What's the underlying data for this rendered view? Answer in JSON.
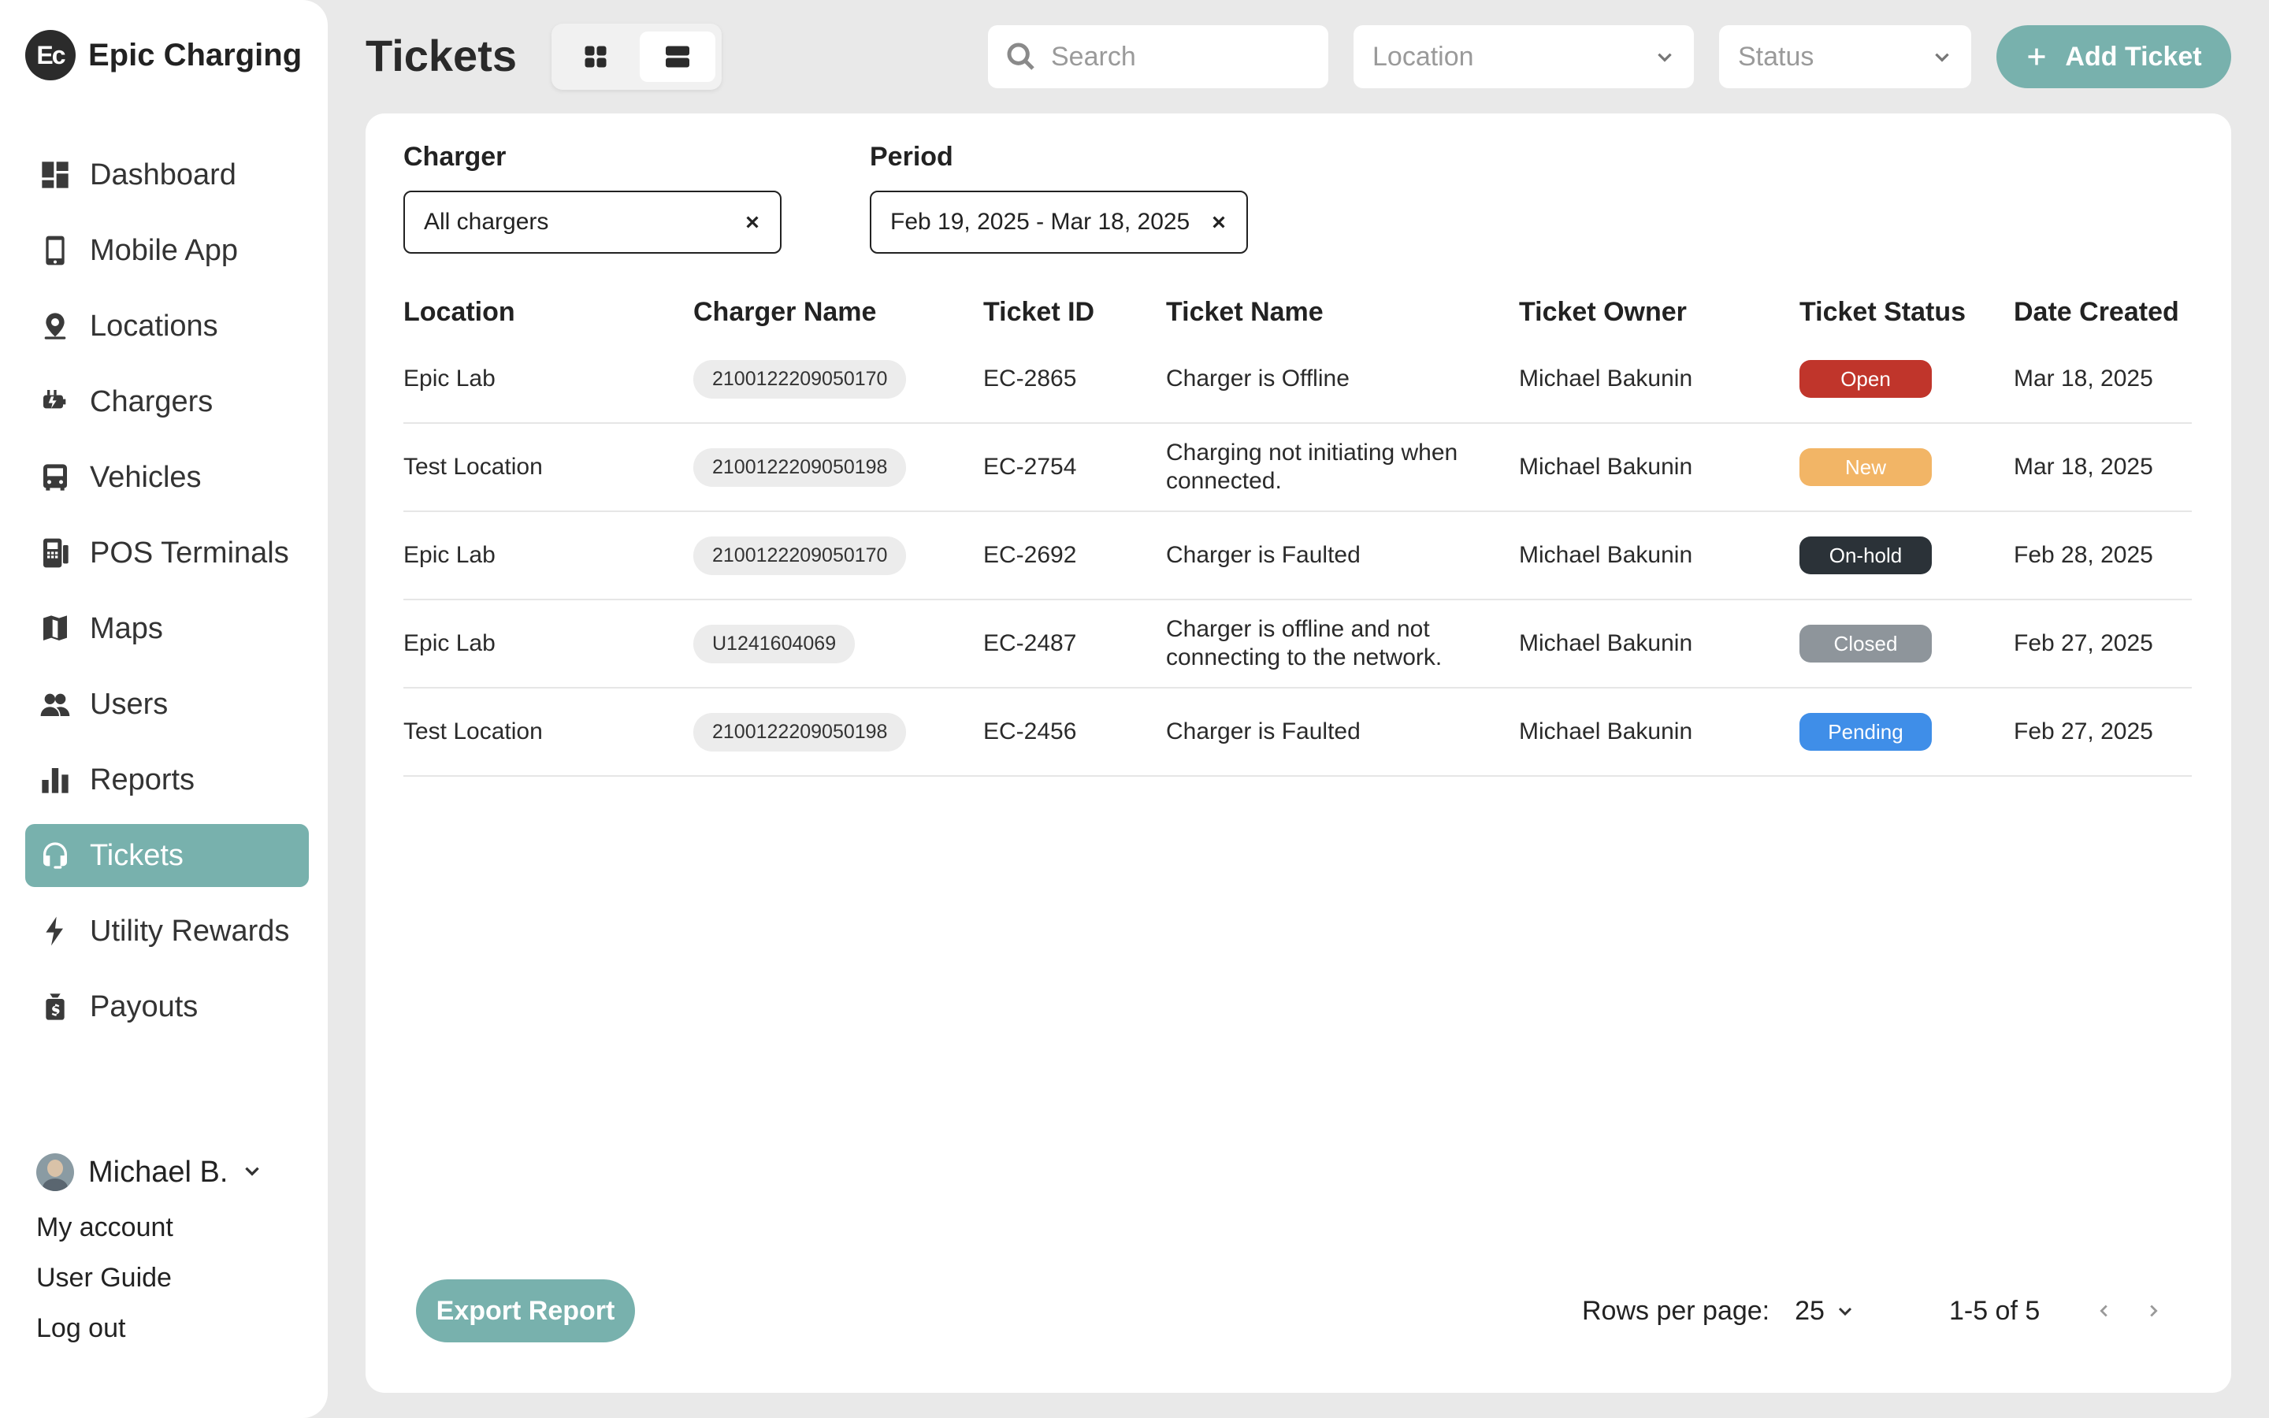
{
  "brand": {
    "logo_text": "Ec",
    "name": "Epic Charging"
  },
  "nav": [
    {
      "label": "Dashboard",
      "icon": "dashboard-icon"
    },
    {
      "label": "Mobile App",
      "icon": "mobile-phone-icon"
    },
    {
      "label": "Locations",
      "icon": "location-pin-icon"
    },
    {
      "label": "Chargers",
      "icon": "ev-charger-icon"
    },
    {
      "label": "Vehicles",
      "icon": "bus-icon"
    },
    {
      "label": "POS Terminals",
      "icon": "pos-terminal-icon"
    },
    {
      "label": "Maps",
      "icon": "map-icon"
    },
    {
      "label": "Users",
      "icon": "users-icon"
    },
    {
      "label": "Reports",
      "icon": "bar-chart-icon"
    },
    {
      "label": "Tickets",
      "icon": "headset-icon",
      "active": true
    },
    {
      "label": "Utility Rewards",
      "icon": "lightning-bolt-icon"
    },
    {
      "label": "Payouts",
      "icon": "money-bag-icon"
    }
  ],
  "user": {
    "name": "Michael B.",
    "links": [
      "My account",
      "User Guide",
      "Log out"
    ]
  },
  "header": {
    "title": "Tickets",
    "search_placeholder": "Search",
    "location_placeholder": "Location",
    "status_placeholder": "Status",
    "add_button": "Add Ticket"
  },
  "filters": {
    "charger": {
      "label": "Charger",
      "value": "All chargers"
    },
    "period": {
      "label": "Period",
      "value": "Feb 19, 2025 - Mar 18, 2025"
    }
  },
  "table": {
    "columns": [
      "Location",
      "Charger Name",
      "Ticket ID",
      "Ticket Name",
      "Ticket Owner",
      "Ticket Status",
      "Date Created"
    ],
    "rows": [
      {
        "location": "Epic Lab",
        "charger": "2100122209050170",
        "id": "EC-2865",
        "name": "Charger is Offline",
        "owner": "Michael Bakunin",
        "status": "Open",
        "date": "Mar 18, 2025"
      },
      {
        "location": "Test Location",
        "charger": "2100122209050198",
        "id": "EC-2754",
        "name": "Charging not initiating when connected.",
        "owner": "Michael Bakunin",
        "status": "New",
        "date": "Mar 18, 2025"
      },
      {
        "location": "Epic Lab",
        "charger": "2100122209050170",
        "id": "EC-2692",
        "name": "Charger is Faulted",
        "owner": "Michael Bakunin",
        "status": "On-hold",
        "date": "Feb 28, 2025"
      },
      {
        "location": "Epic Lab",
        "charger": "U1241604069",
        "id": "EC-2487",
        "name": "Charger is offline and not connecting to the network.",
        "owner": "Michael Bakunin",
        "status": "Closed",
        "date": "Feb 27, 2025"
      },
      {
        "location": "Test Location",
        "charger": "2100122209050198",
        "id": "EC-2456",
        "name": "Charger is Faulted",
        "owner": "Michael Bakunin",
        "status": "Pending",
        "date": "Feb 27, 2025"
      }
    ]
  },
  "status_colors": {
    "Open": "#c0352b",
    "New": "#f2b566",
    "On-hold": "#2b3238",
    "Closed": "#8e959b",
    "Pending": "#3f8ee8"
  },
  "accent_color": "#78b1ad",
  "footer": {
    "export_button": "Export Report",
    "rows_per_page_label": "Rows per page:",
    "rows_per_page_value": "25",
    "range": "1-5 of 5"
  }
}
